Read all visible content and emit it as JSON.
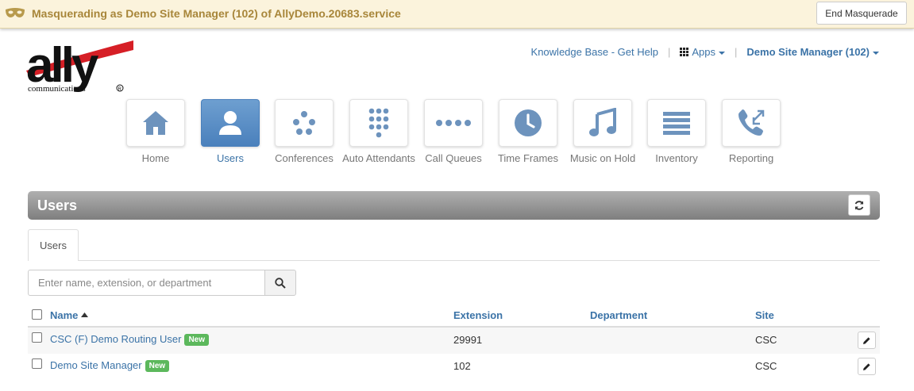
{
  "masquerade": {
    "text": "Masquerading as Demo Site Manager (102) of AllyDemo.20683.service",
    "end_label": "End Masquerade"
  },
  "logo": {
    "brand": "ally",
    "tagline": "communications"
  },
  "top_nav": {
    "knowledge_base": "Knowledge Base - Get Help",
    "apps": "Apps",
    "user": "Demo Site Manager (102)"
  },
  "nav": [
    {
      "label": "Home",
      "icon": "home-icon",
      "active": false
    },
    {
      "label": "Users",
      "icon": "user-icon",
      "active": true
    },
    {
      "label": "Conferences",
      "icon": "conference-icon",
      "active": false
    },
    {
      "label": "Auto Attendants",
      "icon": "keypad-icon",
      "active": false
    },
    {
      "label": "Call Queues",
      "icon": "queue-dots-icon",
      "active": false
    },
    {
      "label": "Time Frames",
      "icon": "clock-icon",
      "active": false
    },
    {
      "label": "Music on Hold",
      "icon": "music-note-icon",
      "active": false
    },
    {
      "label": "Inventory",
      "icon": "list-icon",
      "active": false
    },
    {
      "label": "Reporting",
      "icon": "phone-arrows-icon",
      "active": false
    }
  ],
  "panel": {
    "title": "Users"
  },
  "tabs": [
    {
      "label": "Users"
    }
  ],
  "search": {
    "placeholder": "Enter name, extension, or department"
  },
  "table": {
    "headers": {
      "name": "Name",
      "extension": "Extension",
      "department": "Department",
      "site": "Site"
    },
    "rows": [
      {
        "name": "CSC (F) Demo Routing User",
        "badge": "New",
        "extension": "29991",
        "department": "",
        "site": "CSC"
      },
      {
        "name": "Demo Site Manager",
        "badge": "New",
        "extension": "102",
        "department": "",
        "site": "CSC"
      }
    ]
  },
  "colors": {
    "accent": "#3b73a7",
    "active_tile": "#4a80bc",
    "badge": "#5cb85c",
    "masquerade_bg": "#fbf3dc",
    "masquerade_text": "#a8863a",
    "logo_red": "#d61f26"
  }
}
